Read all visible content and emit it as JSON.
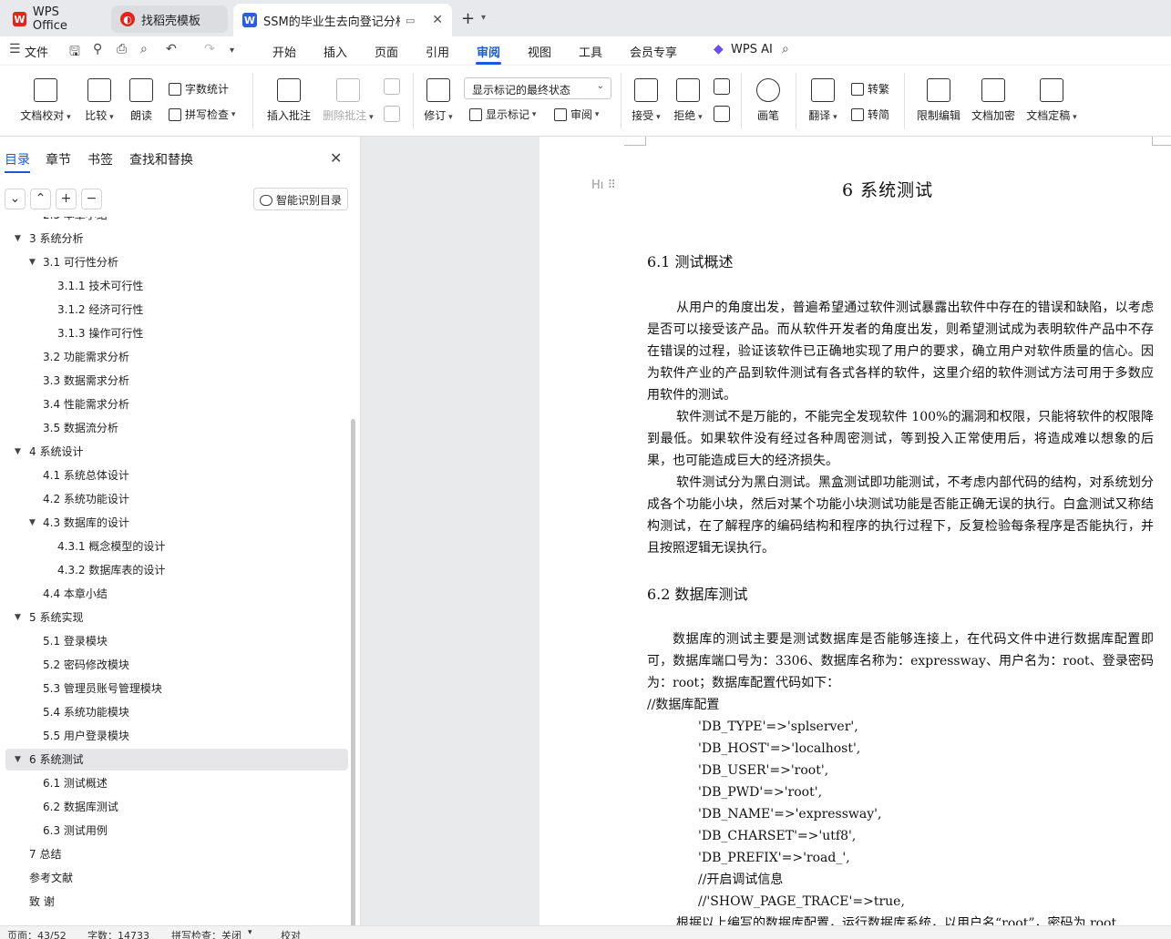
{
  "tabs": [
    {
      "label": "WPS Office"
    },
    {
      "label": "找稻壳模板"
    },
    {
      "label": "SSM的毕业生去向登记分析管"
    }
  ],
  "menu": {
    "file": "文件",
    "items": [
      "开始",
      "插入",
      "页面",
      "引用",
      "审阅",
      "视图",
      "工具",
      "会员专享"
    ],
    "active": "审阅",
    "wps_ai": "WPS AI"
  },
  "ribbon": {
    "proofread": "文档校对",
    "compare": "比较",
    "read_aloud": "朗读",
    "word_count": "字数统计",
    "spell_check": "拼写检查",
    "insert_comment": "插入批注",
    "delete_comment": "删除批注",
    "revise": "修订",
    "display_state": "显示标记的最终状态",
    "show_marks": "显示标记",
    "review": "审阅",
    "accept": "接受",
    "reject": "拒绝",
    "pen": "画笔",
    "translate": "翻译",
    "to_traditional": "转繁",
    "to_simplified": "转简",
    "restrict_edit": "限制编辑",
    "encrypt": "文档加密",
    "finalize": "文档定稿"
  },
  "sidebar": {
    "tabs": [
      "目录",
      "章节",
      "书签",
      "查找和替换"
    ],
    "smart_toc": "智能识别目录",
    "toc": [
      {
        "text": "2.5 本章小结",
        "level": 2,
        "arrow": false
      },
      {
        "text": "3  系统分析",
        "level": 1,
        "arrow": true
      },
      {
        "text": "3.1 可行性分析",
        "level": 2,
        "arrow": true
      },
      {
        "text": "3.1.1  技术可行性",
        "level": 3,
        "arrow": false
      },
      {
        "text": "3.1.2  经济可行性",
        "level": 3,
        "arrow": false
      },
      {
        "text": "3.1.3  操作可行性",
        "level": 3,
        "arrow": false
      },
      {
        "text": "3.2  功能需求分析",
        "level": 2,
        "arrow": false
      },
      {
        "text": "3.3  数据需求分析",
        "level": 2,
        "arrow": false
      },
      {
        "text": "3.4  性能需求分析",
        "level": 2,
        "arrow": false
      },
      {
        "text": "3.5 数据流分析",
        "level": 2,
        "arrow": false
      },
      {
        "text": "4    系统设计",
        "level": 1,
        "arrow": true
      },
      {
        "text": "4.1 系统总体设计",
        "level": 2,
        "arrow": false
      },
      {
        "text": "4.2 系统功能设计",
        "level": 2,
        "arrow": false
      },
      {
        "text": "4.3  数据库的设计",
        "level": 2,
        "arrow": true
      },
      {
        "text": "4.3.1  概念模型的设计",
        "level": 3,
        "arrow": false
      },
      {
        "text": "4.3.2  数据库表的设计",
        "level": 3,
        "arrow": false
      },
      {
        "text": "4.4 本章小结",
        "level": 2,
        "arrow": false
      },
      {
        "text": "5    系统实现",
        "level": 1,
        "arrow": true
      },
      {
        "text": "5.1 登录模块",
        "level": 2,
        "arrow": false
      },
      {
        "text": "5.2 密码修改模块",
        "level": 2,
        "arrow": false
      },
      {
        "text": "5.3 管理员账号管理模块",
        "level": 2,
        "arrow": false
      },
      {
        "text": "5.4 系统功能模块",
        "level": 2,
        "arrow": false
      },
      {
        "text": "5.5 用户登录模块",
        "level": 2,
        "arrow": false
      },
      {
        "text": "6    系统测试",
        "level": 1,
        "arrow": true,
        "selected": true
      },
      {
        "text": "6.1 测试概述",
        "level": 2,
        "arrow": false
      },
      {
        "text": "6.2 数据库测试",
        "level": 2,
        "arrow": false
      },
      {
        "text": "6.3 测试用例",
        "level": 2,
        "arrow": false
      },
      {
        "text": "7    总结",
        "level": 1,
        "arrow": false
      },
      {
        "text": "参考文献",
        "level": 1,
        "arrow": false
      },
      {
        "text": "致  谢",
        "level": 1,
        "arrow": false
      }
    ]
  },
  "document": {
    "heading1": "6    系统测试",
    "heading_marker": "H",
    "h2_1": "6.1 测试概述",
    "para1": "从用户的角度出发，普遍希望通过软件测试暴露出软件中存在的错误和缺陷，以考虑是否可以接受该产品。而从软件开发者的角度出发，则希望测试成为表明软件产品中不存在错误的过程，验证该软件已正确地实现了用户的要求，确立用户对软件质量的信心。因为软件产业的产品到软件测试有各式各样的软件，这里介绍的软件测试方法可用于多数应用软件的测试。",
    "para2": "软件测试不是万能的，不能完全发现软件 100%的漏洞和权限，只能将软件的权限降到最低。如果软件没有经过各种周密测试，等到投入正常使用后，将造成难以想象的后果，也可能造成巨大的经济损失。",
    "para3": "软件测试分为黑白测试。黑盒测试即功能测试，不考虑内部代码的结构，对系统划分成各个功能小块，然后对某个功能小块测试功能是否能正确无误的执行。白盒测试又称结构测试，在了解程序的编码结构和程序的执行过程下，反复检验每条程序是否能执行，并且按照逻辑无误执行。",
    "h2_2": "6.2 数据库测试",
    "para4": "数据库的测试主要是测试数据库是否能够连接上，在代码文件中进行数据库配置即可，数据库端口号为：3306、数据库名称为：expressway、用户名为：root、登录密码为：root；数据库配置代码如下：",
    "code_comment": "//数据库配置",
    "code": [
      "'DB_TYPE'=>'splserver',",
      "'DB_HOST'=>'localhost',",
      "'DB_USER'=>'root',",
      "'DB_PWD'=>'root',",
      "'DB_NAME'=>'expressway',",
      "'DB_CHARSET'=>'utf8',",
      "'DB_PREFIX'=>'road_',",
      "//开启调试信息",
      "//'SHOW_PAGE_TRACE'=>true,"
    ],
    "para5": "根据以上编写的数据库配置，运行数据库系统，以用户名“root”，密码为 root"
  },
  "status": {
    "page": "页面：43/52",
    "words": "字数：14733",
    "spell": "拼写检查：关闭",
    "proof": "校对"
  }
}
